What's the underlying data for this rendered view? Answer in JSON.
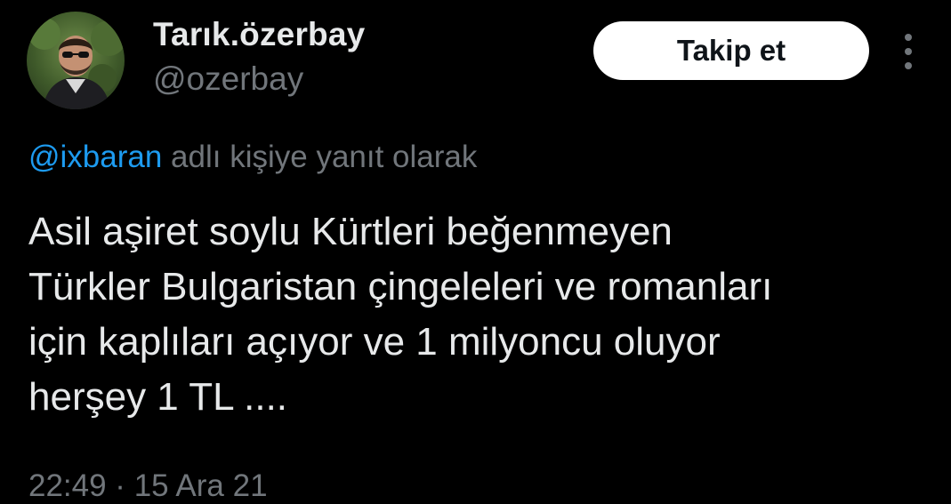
{
  "author": {
    "display_name": "Tarık.özerbay",
    "handle": "@ozerbay",
    "avatar": "profile-photo"
  },
  "follow_button": {
    "label": "Takip et"
  },
  "more_menu": {
    "icon": "more-vertical-icon"
  },
  "reply_context": {
    "mention": "@ixbaran",
    "suffix": " adlı kişiye yanıt olarak"
  },
  "tweet": {
    "lines": [
      "Asil aşiret soylu Kürtleri beğenmeyen",
      "Türkler Bulgaristan çingeleleri ve romanları",
      "için kaplıları açıyor ve 1 milyoncu oluyor",
      "herşey 1 TL ...."
    ]
  },
  "meta": {
    "timestamp": "22:49 · 15 Ara 21"
  },
  "colors": {
    "background": "#000000",
    "text": "#e7e9ea",
    "secondary": "#71767b",
    "link": "#1d9bf0",
    "button_bg": "#ffffff",
    "button_text": "#0f1419"
  }
}
